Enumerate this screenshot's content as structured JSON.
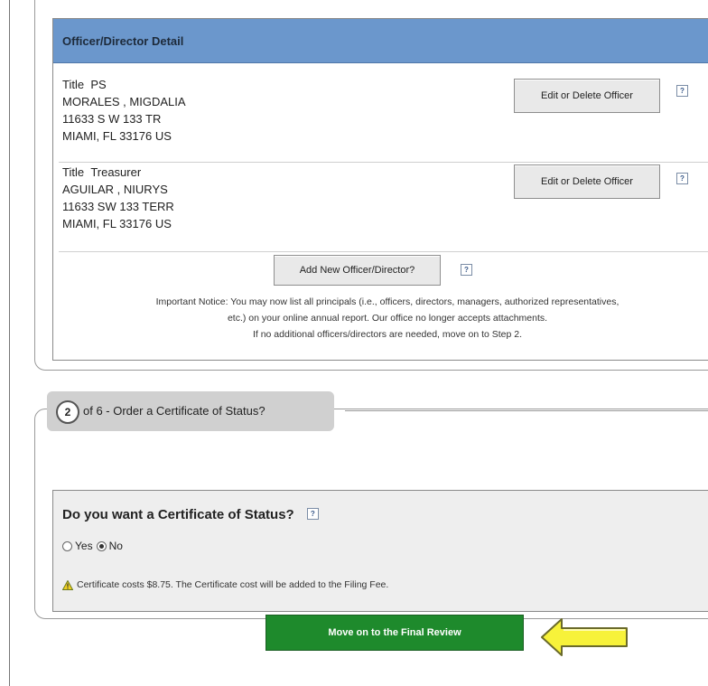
{
  "officers_panel": {
    "header": "Officer/Director Detail",
    "officers": [
      {
        "title_label": "Title",
        "title": "PS",
        "name": "MORALES , MIGDALIA",
        "address1": "11633 S W 133 TR",
        "address2": "MIAMI,  FL  33176 US",
        "edit_label": "Edit or Delete Officer"
      },
      {
        "title_label": "Title",
        "title": "Treasurer",
        "name": "AGUILAR , NIURYS",
        "address1": "11633 SW 133 TERR",
        "address2": "MIAMI,  FL  33176 US",
        "edit_label": "Edit or Delete Officer"
      }
    ],
    "add_button": "Add New Officer/Director?",
    "notice_line1": "Important Notice: You may now list all principals (i.e., officers, directors, managers, authorized representatives,",
    "notice_line2": "etc.) on your online annual report. Our office no longer accepts attachments.",
    "notice_line3": "If no additional officers/directors are needed, move on to Step 2.",
    "help_glyph": "?"
  },
  "step2": {
    "number": "2",
    "legend": "of 6 - Order a Certificate of Status?",
    "question": "Do you want a Certificate of Status?",
    "options": [
      {
        "label": "Yes",
        "selected": false
      },
      {
        "label": "No",
        "selected": true
      }
    ],
    "note": "Certificate costs $8.75. The Certificate cost will be added to the Filing Fee.",
    "warning_icon": "warning-icon"
  },
  "final_button": "Move on to the Final Review",
  "colors": {
    "header_blue": "#6b97cc",
    "final_green": "#1e8a2c",
    "arrow_yellow": "#f7f23a"
  }
}
